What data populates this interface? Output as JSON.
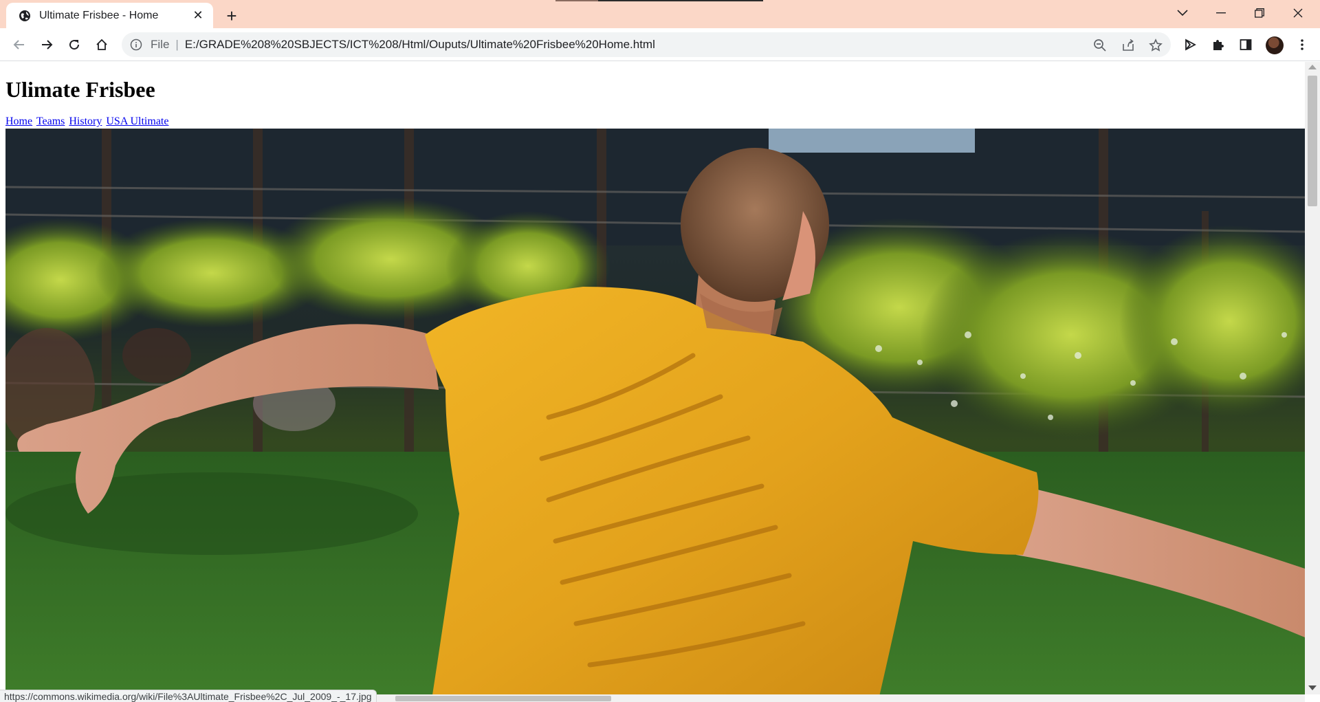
{
  "browser": {
    "tab": {
      "title": "Ultimate Frisbee - Home",
      "favicon": "globe-icon",
      "close_icon": "close-icon"
    },
    "new_tab_icon": "plus-icon",
    "window_controls": [
      "tab-search-icon",
      "minimize-icon",
      "restore-icon",
      "close-icon"
    ],
    "nav_icons": [
      "back-arrow-icon",
      "forward-arrow-icon",
      "reload-icon",
      "home-icon"
    ],
    "omnibox": {
      "scheme_label": "File",
      "separator": "|",
      "url": "E:/GRADE%208%20SBJECTS/ICT%208/Html/Ouputs/Ultimate%20Frisbee%20Home.html",
      "icons": [
        "zoom-out-icon",
        "share-icon",
        "bookmark-star-icon"
      ]
    },
    "extension_icons": [
      "send-arrow-icon",
      "extensions-puzzle-icon",
      "side-panel-icon",
      "profile-avatar",
      "kebab-menu-icon"
    ]
  },
  "page": {
    "heading": "Ulimate Frisbee",
    "nav_links": [
      "Home",
      "Teams",
      "History",
      "USA Ultimate"
    ],
    "hero_image": "frisbee-player-yellow-shirt-photo"
  },
  "status_bar": {
    "url": "https://commons.wikimedia.org/wiki/File%3AUltimate_Frisbee%2C_Jul_2009_-_17.jpg"
  },
  "colors": {
    "titlebar": "#fbd7c7",
    "link": "#0000ee",
    "shirt": "#e6a51d",
    "grass": "#2f6b24"
  }
}
